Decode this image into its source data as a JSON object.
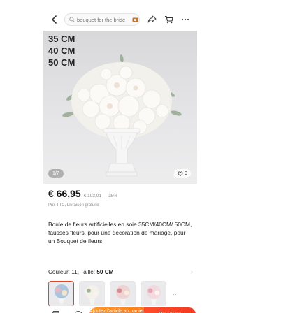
{
  "search": {
    "placeholder": "bouquet for the bride"
  },
  "hero": {
    "size_lines": [
      "35 CM",
      "40 CM",
      "50 CM"
    ],
    "counter": "1/7",
    "likes": "0"
  },
  "product": {
    "price": "€ 66,95",
    "old_price": "€ 103,01",
    "discount": "-35%",
    "tax_note": "Prix TTC, Livraison gratuite",
    "title": "Boule de fleurs artificielles en soie 35CM/40CM/ 50CM, fausses fleurs, pour une décoration de mariage, pour un Bouquet de fleurs"
  },
  "variant": {
    "label": "Couleur: 11, Taille:",
    "value": "50 CM"
  },
  "bottom": {
    "add_to_cart": "Ajoutez l'article au panier",
    "buy_now": "Buy Now"
  },
  "colors": {
    "accent": "#f23a1f",
    "orange": "#ff8a24",
    "vase": "#f4f4f4"
  }
}
